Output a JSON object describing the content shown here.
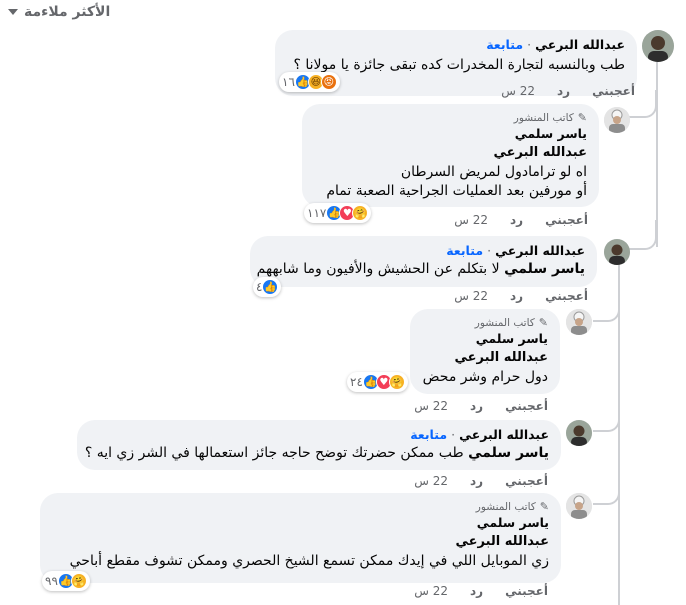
{
  "sort": {
    "label": "الأكثر ملاءمة"
  },
  "ui": {
    "like": "أعجبني",
    "reply": "رد",
    "follow": "متابعة",
    "author": "كاتب المنشور",
    "dot": "·",
    "time": "22 س"
  },
  "comments": [
    {
      "name": "عبدالله البرعي",
      "text": "طب وبالنسبه لتجارة المخدرات كده تبقى جائزة يا مولانا ؟",
      "reactions": [
        "angry",
        "haha",
        "like"
      ],
      "count": "١٦"
    },
    {
      "name": "ياسر سلمي",
      "mention": "عبدالله البرعي",
      "lines": [
        "اه لو ترامادول لمريض السرطان",
        "أو مورفين بعد العمليات الجراحية الصعبة تمام"
      ],
      "reactions": [
        "care",
        "love",
        "like"
      ],
      "count": "١١٧"
    },
    {
      "name": "عبدالله البرعي",
      "mention": "ياسر سلمي",
      "text": "لا بتكلم عن الحشيش والأفيون وما شابههم",
      "reactions": [
        "like"
      ],
      "count": "٤"
    },
    {
      "name": "ياسر سلمي",
      "mention": "عبدالله البرعي",
      "text": "دول حرام وشر محض",
      "reactions": [
        "care",
        "love",
        "like"
      ],
      "count": "٢٤"
    },
    {
      "name": "عبدالله البرعي",
      "mention": "ياسر سلمي",
      "text": "طب ممكن حضرتك توضح حاجه جائز استعمالها في الشر زي ايه ؟"
    },
    {
      "name": "ياسر سلمي",
      "mention": "عبدالله البرعي",
      "text": "زي الموبايل اللي في إيدك ممكن تسمع الشيخ الحصري وممكن تشوف مقطع أباحي",
      "reactions": [
        "care",
        "like"
      ],
      "count": "٩٩"
    }
  ]
}
